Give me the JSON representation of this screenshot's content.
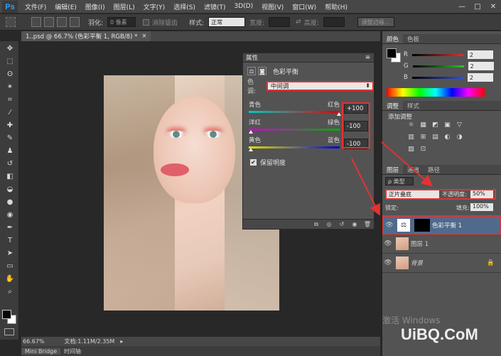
{
  "app": {
    "logo": "Ps",
    "menus": [
      "文件(F)",
      "编辑(E)",
      "图像(I)",
      "图层(L)",
      "文字(Y)",
      "选择(S)",
      "滤镜(T)",
      "3D(D)",
      "视图(V)",
      "窗口(W)",
      "帮助(H)"
    ],
    "window_controls": [
      "—",
      "□",
      "✕"
    ]
  },
  "options": {
    "feather_label": "羽化:",
    "feather_value": "0 像素",
    "antialias_label": "消除锯齿",
    "style_label": "样式:",
    "style_value": "正常",
    "width_label": "宽度:",
    "height_label": "高度:",
    "refine_label": "调整边缘..."
  },
  "document": {
    "tab_title": "1..psd @ 66.7% (色彩平衡 1, RGB/8) *",
    "tab_close": "×"
  },
  "status": {
    "zoom": "66.67%",
    "doc_size": "文档:1.11M/2.35M"
  },
  "bottom_tabs": [
    "Mini Bridge",
    "时间轴"
  ],
  "properties": {
    "header": "属性",
    "title": "色彩平衡",
    "tone_label": "色调:",
    "tone_value": "中间调",
    "sliders": [
      {
        "left": "青色",
        "right": "红色",
        "value": "+100",
        "pos": 1.0,
        "gradient": [
          "#00c8c8",
          "#e00000"
        ]
      },
      {
        "left": "洋红",
        "right": "绿色",
        "value": "-100",
        "pos": 0.0,
        "gradient": [
          "#d000d0",
          "#00b000"
        ]
      },
      {
        "left": "黄色",
        "right": "蓝色",
        "value": "-100",
        "pos": 0.0,
        "gradient": [
          "#e0e000",
          "#0000e0"
        ]
      }
    ],
    "preserve_label": "保留明度",
    "preserve_checked": "✔"
  },
  "color_panel": {
    "tabs": [
      "颜色",
      "色板"
    ],
    "rows": [
      {
        "label": "R",
        "value": "2",
        "color": "#e03030"
      },
      {
        "label": "G",
        "value": "2",
        "color": "#30c030"
      },
      {
        "label": "B",
        "value": "2",
        "color": "#3050e0"
      }
    ]
  },
  "adjust_panel": {
    "tabs": [
      "调整",
      "样式"
    ],
    "add_label": "添加调整",
    "icons": [
      "☼",
      "▦",
      "◩",
      "▣",
      "▽",
      "▥",
      "⊞",
      "▤",
      "◐",
      "◑",
      "▨",
      "⊡"
    ]
  },
  "layers_panel": {
    "tabs": [
      "图层",
      "通道",
      "路径"
    ],
    "filter_label": "ρ 类型",
    "blend_mode": "正片叠底",
    "opacity_label": "不透明度:",
    "opacity_value": "50%",
    "lock_label": "锁定:",
    "fill_label": "填充:",
    "fill_value": "100%",
    "layers": [
      {
        "name": "色彩平衡 1",
        "selected": true
      },
      {
        "name": "图层 1",
        "selected": false
      },
      {
        "name": "背景",
        "selected": false
      }
    ]
  },
  "watermark": {
    "activate": "激活 Windows",
    "site": "UiBQ.CoM"
  },
  "colors": {
    "red_highlight": "#e33232",
    "accent": "#2fa3ff"
  }
}
